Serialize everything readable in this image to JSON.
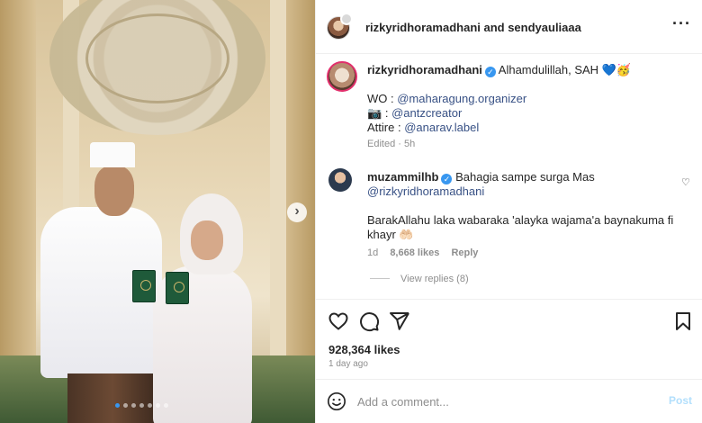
{
  "header": {
    "usernames": "rizkyridhoramadhani and sendyauliaaa",
    "more_icon": "more-horizontal-icon"
  },
  "caption": {
    "username": "rizkyridhoramadhani",
    "verified_icon": "verified-badge-icon",
    "text": "Alhamdulillah, SAH 💙🥳",
    "wo_label": "WO :",
    "wo_handle": "@maharagung.organizer",
    "camera_emoji": "📷",
    "camera_label": ":",
    "camera_handle": "@antzcreator",
    "attire_label": "Attire :",
    "attire_handle": "@anarav.label",
    "edited": "Edited · 5h"
  },
  "comment": {
    "username": "muzammilhb",
    "verified_icon": "verified-badge-icon",
    "text_line1": "Bahagia sampe surga Mas",
    "mention": "@rizkyridhoramadhani",
    "text_line2": "BarakAllahu laka wabaraka 'alayka wajama'a baynakuma fi",
    "text_line3": "khayr 🤲🏻",
    "time": "1d",
    "likes": "8,668 likes",
    "reply_label": "Reply",
    "view_replies": "View replies (8)",
    "heart_icon": "heart-outline-small-icon"
  },
  "actions": {
    "icons": [
      "heart-icon",
      "comment-icon",
      "share-icon",
      "bookmark-icon"
    ],
    "likes": "928,364 likes",
    "time_ago": "1 day ago"
  },
  "add_comment": {
    "emoji_icon": "emoji-icon",
    "placeholder": "Add a comment...",
    "post_label": "Post"
  },
  "carousel": {
    "next_icon": "chevron-right-icon",
    "dot_count": 7,
    "active_index": 0
  }
}
